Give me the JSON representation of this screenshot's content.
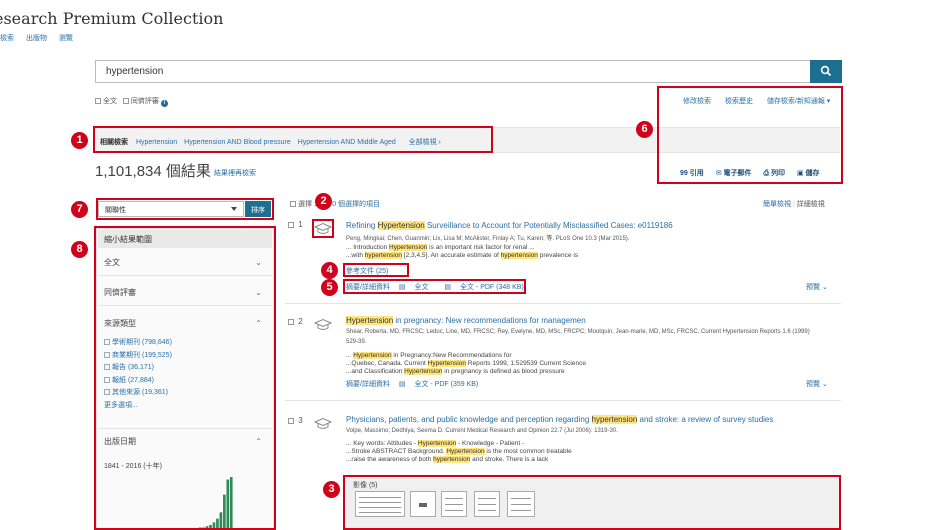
{
  "app_title": "esearch Premium Collection",
  "top_nav": [
    "檢索",
    "出版物",
    "瀏覽"
  ],
  "search": {
    "value": "hypertension"
  },
  "search_options": {
    "full_text": "全文",
    "peer_reviewed": "同儕評審"
  },
  "right_links": [
    "修改檢索",
    "檢索歷史",
    "儲存檢索/新知通報 ▾"
  ],
  "related": {
    "label": "相關檢索",
    "terms": [
      "Hypertension",
      "Hypertension AND Blood pressure",
      "Hypertension AND Middle Aged"
    ],
    "view_all": "全部檢視 ›"
  },
  "results": {
    "count": "1,101,834 個結果",
    "sub_link": "結果裡再檢索"
  },
  "actions": [
    "99 引用",
    "✉ 電子郵件",
    "⎙ 列印",
    "▣ 儲存"
  ],
  "sort": {
    "value": "關聯性",
    "button": "排序"
  },
  "sidebar": {
    "header": "縮小結果範圍",
    "full_text": "全文",
    "peer_reviewed": "同儕評審",
    "source_type": "來源類型",
    "sources": [
      "學術期刊 (798,646)",
      "商業期刊 (199,525)",
      "報告 (36,171)",
      "報紙 (27,884)",
      "其他來源 (19,361)"
    ],
    "more": "更多選項...",
    "pub_date": "出版日期",
    "date_range": "1841 - 2016 (十年)",
    "histogram": [
      1,
      1,
      1,
      1,
      1,
      1,
      1,
      1,
      1,
      1,
      1,
      1,
      1,
      1,
      1,
      1,
      2,
      2,
      3,
      4,
      6,
      9,
      14,
      28,
      40,
      42
    ]
  },
  "selection": {
    "checkbox_label": "選擇 1-",
    "selected": "0 個選擇的項目"
  },
  "view_modes": {
    "simple": "簡單檢視",
    "detail": "詳細檢視"
  },
  "result_items": [
    {
      "num": "1",
      "title_parts": [
        [
          "Refining ",
          false
        ],
        [
          "Hypertension",
          true
        ],
        [
          " Surveillance to Account for Potentially Misclassified Cases: e0119186",
          false
        ]
      ],
      "meta": "Peng, Mingkai; Chen, Guanmin; Lix, Lisa M; McAlister, Finlay A; Tu, Karen; 等. PLoS One 10.3 (Mar 2015).",
      "snippets": [
        [
          [
            "... Introduction ",
            false
          ],
          [
            "Hypertension",
            true
          ],
          [
            " is an important risk factor for renal ...",
            false
          ]
        ],
        [
          [
            "...with ",
            false
          ],
          [
            "hypertension",
            true
          ],
          [
            " [2,3,4,5]. An accurate estimate of ",
            false
          ],
          [
            "hypertension",
            true
          ],
          [
            " prevalence is",
            false
          ]
        ]
      ],
      "refs": "參考文件 (25)",
      "links": [
        "摘要/詳細資料",
        "全文",
        "全文 - PDF (348 KB)"
      ],
      "preview": "預覽 ⌄"
    },
    {
      "num": "2",
      "title_parts": [
        [
          "Hypertension",
          true
        ],
        [
          " in pregnancy: New recommendations for managemen",
          false
        ]
      ],
      "meta": "Shear, Roberta, MD, FRCSC; Leduc, Line, MD, FRCSC; Rey, Evelyne, MD, MSc, FRCPC; Moutquin, Jean-marie, MD, MSc, FRCSC. Current Hypertension Reports 1.6 (1999)",
      "meta2": "529-39.",
      "snippets": [
        [
          [
            "... ",
            false
          ],
          [
            "Hypertension",
            true
          ],
          [
            " in Pregnancy:New Recommendations for",
            false
          ]
        ],
        [
          [
            "...Quebec, Canada. Current ",
            false
          ],
          [
            "Hypertension",
            true
          ],
          [
            " Reports 1999, 1:529539 Current Science",
            false
          ]
        ],
        [
          [
            "...and Classification ",
            false
          ],
          [
            "Hypertension",
            true
          ],
          [
            " in pregnancy is defined as blood pressure",
            false
          ]
        ]
      ],
      "links": [
        "摘要/詳細資料",
        "全文 - PDF (359 KB)"
      ],
      "preview": "預覽 ⌄"
    },
    {
      "num": "3",
      "title_parts": [
        [
          "Physicians, patients, and public knowledge and perception regarding ",
          false
        ],
        [
          "hypertension",
          true
        ],
        [
          " and stroke: a review of survey studies",
          false
        ]
      ],
      "meta": "Volpe, Massimo; Dedhiya, Seema D. Current Medical Research and Opinion 22.7 (Jul 2006): 1319-30.",
      "snippets": [
        [
          [
            "... Key words: Attitudes - ",
            false
          ],
          [
            "Hypertension",
            true
          ],
          [
            " - Knowledge - Patient -",
            false
          ]
        ],
        [
          [
            "...Stroke ABSTRACT Background. ",
            false
          ],
          [
            "Hypertension",
            true
          ],
          [
            " is the most common treatable",
            false
          ]
        ],
        [
          [
            "...raise the awareness of both ",
            false
          ],
          [
            "hypertension",
            true
          ],
          [
            " and stroke. There is a lack",
            false
          ]
        ]
      ],
      "images_label": "影像 (5)"
    }
  ],
  "callouts": [
    "1",
    "2",
    "3",
    "4",
    "5",
    "6",
    "7",
    "8"
  ],
  "colors": {
    "accent": "#1d6f8f",
    "link": "#2a6fa8",
    "highlight": "#ffe680",
    "callout": "#d0021b"
  }
}
